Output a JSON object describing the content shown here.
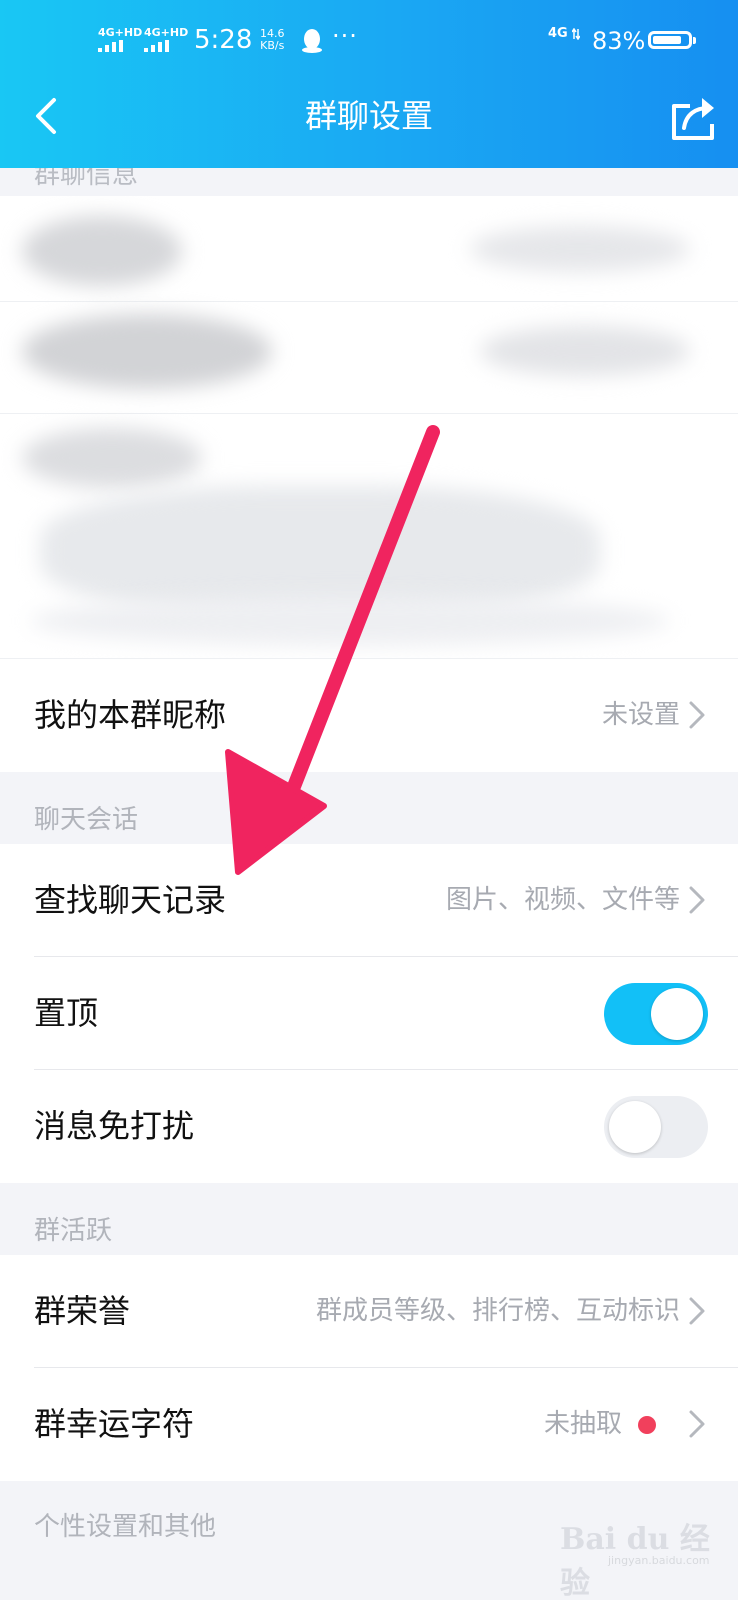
{
  "status_bar": {
    "network_1": "4G+HD",
    "network_2": "4G+HD",
    "time": "5:28",
    "speed_value": "14.6",
    "speed_unit": "KB/s",
    "more": "···",
    "network_3": "4G",
    "battery_percent": "83%",
    "battery_level": 0.83
  },
  "nav": {
    "title": "群聊设置",
    "back_icon": "chevron-left-icon",
    "share_icon": "share-icon"
  },
  "sections": {
    "group_info": "群聊信息",
    "chat_session": "聊天会话",
    "group_activity": "群活跃",
    "personal": "个性设置和其他"
  },
  "rows": {
    "nickname": {
      "label": "我的本群昵称",
      "value": "未设置"
    },
    "search_history": {
      "label": "查找聊天记录",
      "value": "图片、视频、文件等"
    },
    "pin": {
      "label": "置顶",
      "on": true
    },
    "dnd": {
      "label": "消息免打扰",
      "on": false
    },
    "honor": {
      "label": "群荣誉",
      "value": "群成员等级、排行榜、互动标识"
    },
    "lucky": {
      "label": "群幸运字符",
      "value": "未抽取"
    }
  },
  "colors": {
    "accent": "#12c0f7",
    "arrow": "#f0245f",
    "red_dot": "#f1405c"
  },
  "watermark": {
    "text": "Bai du 经验",
    "sub": "jingyan.baidu.com"
  }
}
